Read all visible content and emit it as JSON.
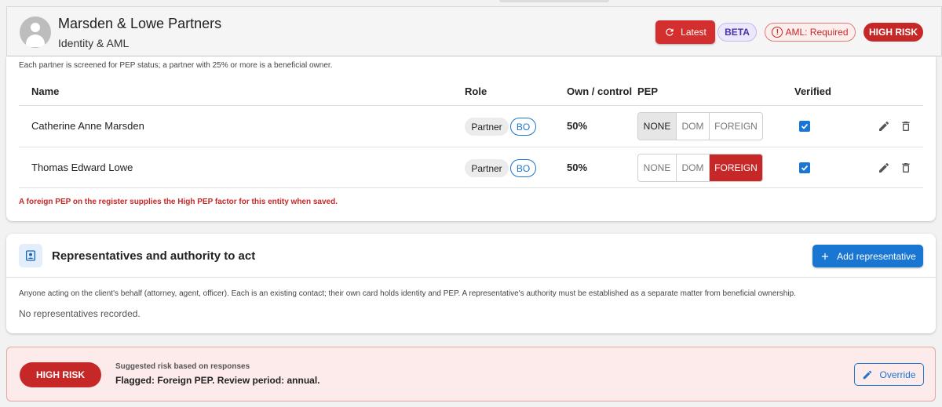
{
  "header": {
    "title": "Marsden & Lowe Partners",
    "subtitle": "Identity & AML",
    "latest_label": "Latest",
    "beta_label": "BETA",
    "aml_label": "AML: Required",
    "risk_label": "HIGH RISK"
  },
  "partners": {
    "note": "Each partner is screened for PEP status; a partner with 25% or more is a beneficial owner.",
    "columns": [
      "Name",
      "Role",
      "Own / control",
      "PEP",
      "Verified"
    ],
    "pep_options": [
      "NONE",
      "DOM",
      "FOREIGN"
    ],
    "rows": [
      {
        "name": "Catherine Anne Marsden",
        "role": "Partner",
        "role_badge": "BO",
        "own": "50%",
        "pep": "NONE",
        "verified": true
      },
      {
        "name": "Thomas Edward Lowe",
        "role": "Partner",
        "role_badge": "BO",
        "own": "50%",
        "pep": "FOREIGN",
        "verified": true
      }
    ],
    "warning": "A foreign PEP on the register supplies the High PEP factor for this entity when saved."
  },
  "representatives": {
    "title": "Representatives and authority to act",
    "add_label": "Add representative",
    "note": "Anyone acting on the client's behalf (attorney, agent, officer). Each is an existing contact; their own card holds identity and PEP. A representative's authority must be established as a separate matter from beneficial ownership.",
    "empty_text": "No representatives recorded."
  },
  "risk": {
    "chip_label": "HIGH RISK",
    "label": "Suggested risk based on responses",
    "text": "Flagged: Foreign PEP. Review period: annual.",
    "override_label": "Override"
  },
  "colors": {
    "danger": "#c62828",
    "primary": "#1976d2",
    "beta": "#4a32a8"
  },
  "icons": [
    "avatar-icon",
    "refresh-icon",
    "alert-icon",
    "checkbox-icon",
    "edit-icon",
    "delete-icon",
    "contact-card-icon",
    "plus-icon",
    "pencil-icon"
  ]
}
